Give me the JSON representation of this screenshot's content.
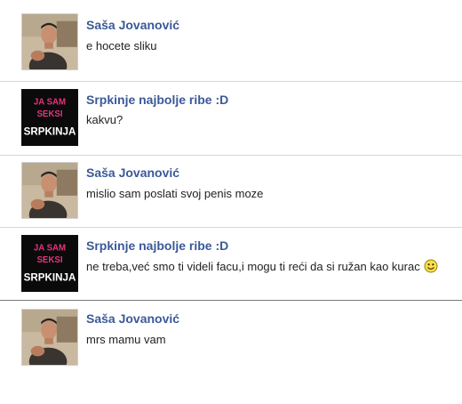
{
  "messages": [
    {
      "sender": "Saša Jovanović",
      "avatar": "man-photo-avatar",
      "text": "e hocete sliku"
    },
    {
      "sender": "Srpkinje najbolje ribe :D",
      "avatar": "group-logo-avatar",
      "avatar_text": [
        "JA SAM",
        "SEKSI",
        "SRPKINJA"
      ],
      "text": "kakvu?"
    },
    {
      "sender": "Saša Jovanović",
      "avatar": "man-photo-avatar",
      "text": "mislio sam poslati svoj penis moze"
    },
    {
      "sender": "Srpkinje najbolje ribe :D",
      "avatar": "group-logo-avatar",
      "avatar_text": [
        "JA SAM",
        "SEKSI",
        "SRPKINJA"
      ],
      "text": "ne treba,već smo ti videli facu,i mogu ti reći da si ružan kao kurac",
      "emoticon": "smiley-icon"
    },
    {
      "sender": "Saša Jovanović",
      "avatar": "man-photo-avatar",
      "text": "mrs mamu vam"
    }
  ],
  "colors": {
    "name": "#3b5998",
    "text": "#222222",
    "separator": "#d7d7d7",
    "logo_pink": "#e8337e"
  }
}
